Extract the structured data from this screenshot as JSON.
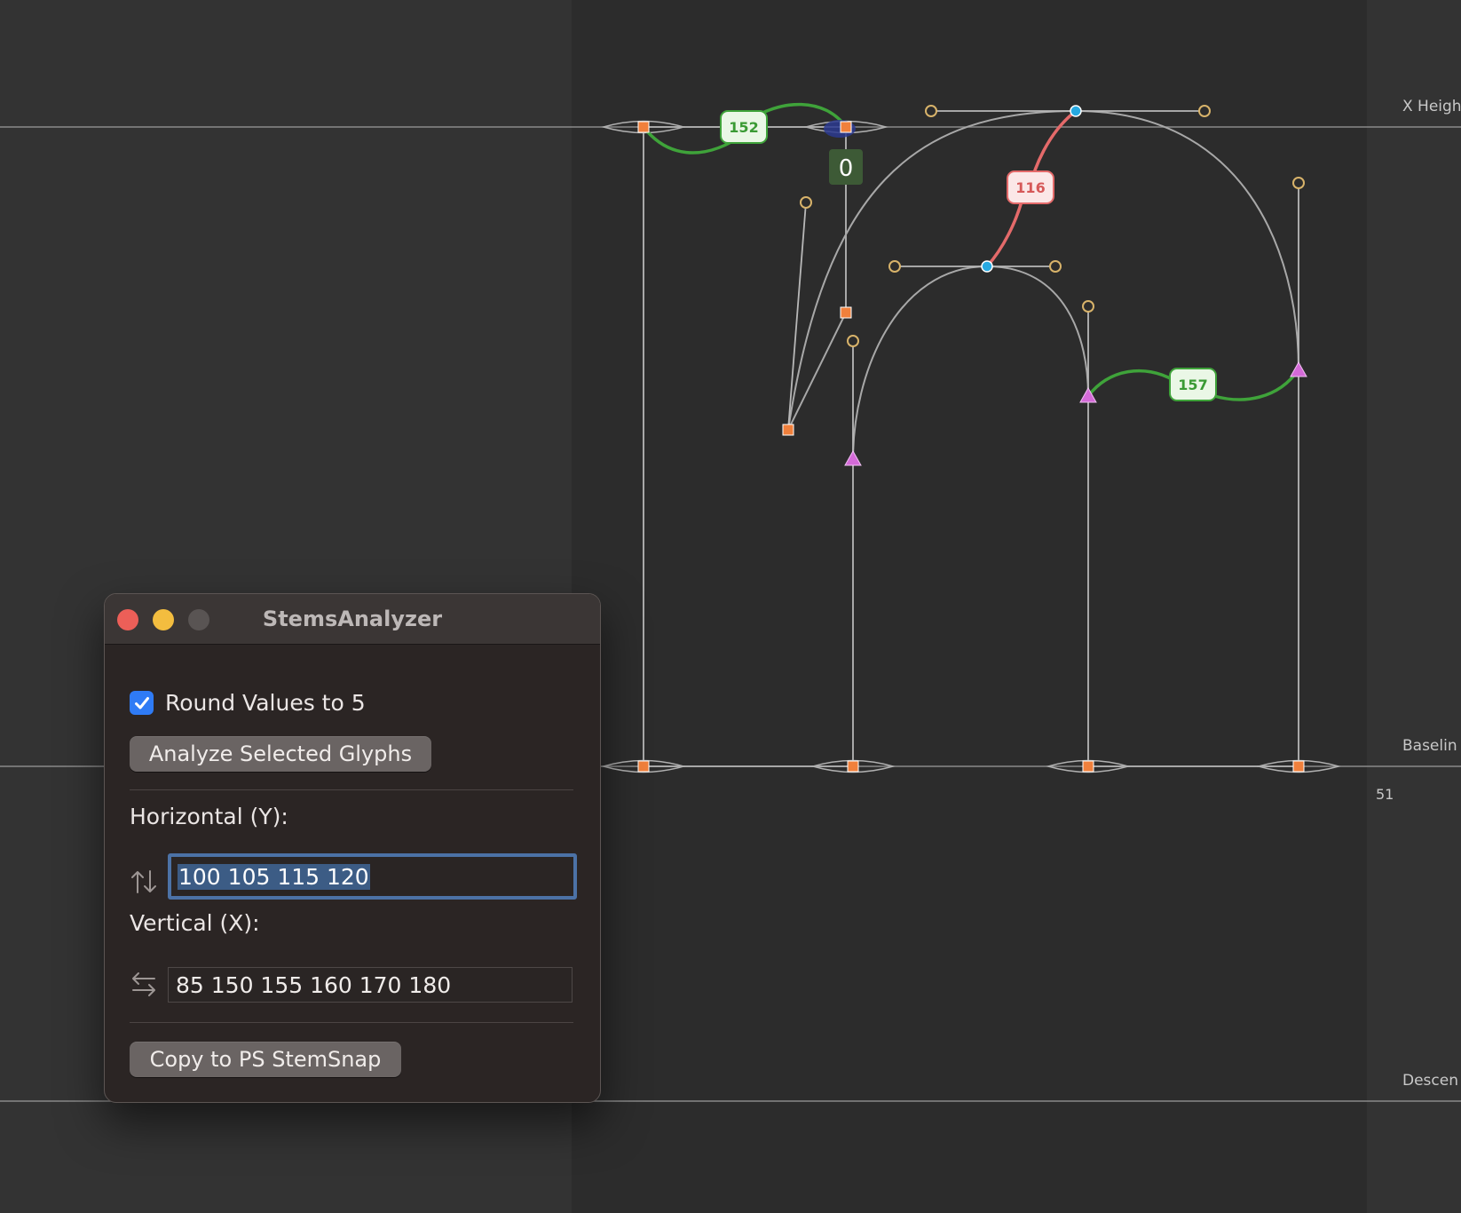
{
  "editor": {
    "metrics": {
      "x_height": "X Heigh",
      "baseline": "Baselin",
      "descender": "Descen"
    },
    "sidebearing_value": "51",
    "stem_badges": {
      "top_serif": "152",
      "arch": "116",
      "shoulder": "157"
    },
    "selection_value": "0",
    "colors": {
      "background": "#333333",
      "glyph_area": "#2c2c2c",
      "outline": "#9a9a9a",
      "badge_green": "#3fa33a",
      "badge_red": "#e46a6a",
      "node_orange": "#f0803c",
      "node_blue": "#27a9e1",
      "node_magenta": "#d46ad8",
      "handle_ring": "#d8b36a"
    }
  },
  "panel": {
    "title": "StemsAnalyzer",
    "round_checkbox": {
      "label": "Round Values to 5",
      "checked": true
    },
    "analyze_button": "Analyze Selected Glyphs",
    "horizontal": {
      "label": "Horizontal (Y):",
      "icon": "arrows-up-down-icon",
      "value": "100 105 115 120"
    },
    "vertical": {
      "label": "Vertical (X):",
      "icon": "arrows-left-right-icon",
      "value": "85 150 155 160 170 180"
    },
    "copy_button": "Copy to PS StemSnap"
  }
}
